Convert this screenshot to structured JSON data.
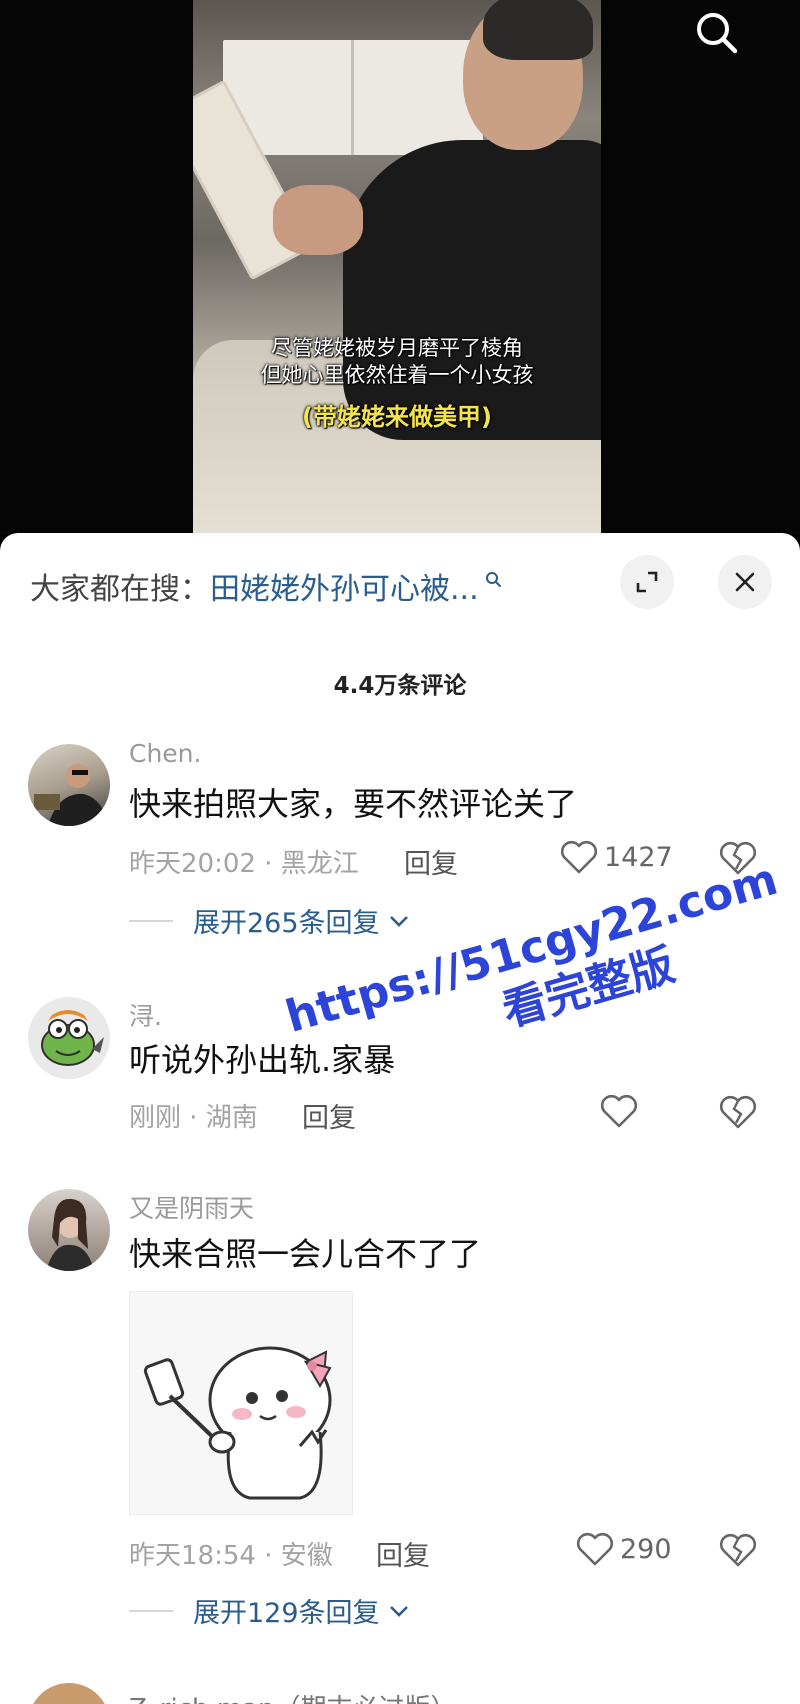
{
  "video": {
    "caption_line1": "尽管姥姥被岁月磨平了棱角",
    "caption_line2": "但她心里依然住着一个小女孩",
    "caption_tag": "(带姥姥来做美甲)"
  },
  "search_bar": {
    "label": "大家都在搜：",
    "query": "田姥姥外孙可心被..."
  },
  "comment_count": "4.4万条评论",
  "comments": [
    {
      "username": "Chen.",
      "text": "快来拍照大家，要不然评论关了",
      "time_location": "昨天20:02 · 黑龙江",
      "reply_label": "回复",
      "likes": "1427",
      "expand_label": "展开265条回复"
    },
    {
      "username": "浔.",
      "text": "听说外孙出轨.家暴",
      "time_location": "刚刚 · 湖南",
      "reply_label": "回复",
      "likes": ""
    },
    {
      "username": "又是阴雨天",
      "text": "快来合照一会儿合不了了",
      "time_location": "昨天18:54 · 安徽",
      "reply_label": "回复",
      "likes": "290",
      "expand_label": "展开129条回复"
    }
  ],
  "next_comment_peek": "Z_rich man（期末必过版）",
  "watermark": {
    "line1": "https://51cgy22.com",
    "line2": "看完整版"
  },
  "colors": {
    "link_blue": "#2a5d8f",
    "watermark_blue": "#2c45d8",
    "caption_yellow": "#f5e34b"
  }
}
